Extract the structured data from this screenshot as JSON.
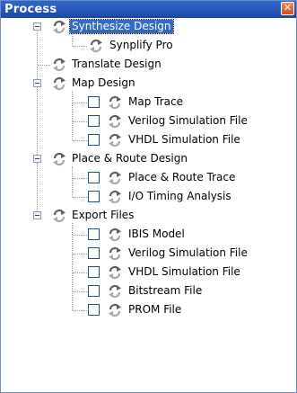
{
  "panel": {
    "title": "Process",
    "close_glyph": "✕"
  },
  "icons": {
    "expander": "minus-box-icon",
    "process": "process-arrows-icon",
    "process_colors": [
      "#5f5f5f",
      "#a8a8a8"
    ]
  },
  "selection_color": "#316ac5",
  "tree": [
    {
      "label": "Synthesize Design",
      "level": 0,
      "expanded": true,
      "selected": true
    },
    {
      "label": "Synplify Pro",
      "level": 1
    },
    {
      "label": "Translate Design",
      "level": 0
    },
    {
      "label": "Map Design",
      "level": 0,
      "expanded": true
    },
    {
      "label": "Map Trace",
      "level": 1,
      "checkbox": true
    },
    {
      "label": "Verilog Simulation File",
      "level": 1,
      "checkbox": true
    },
    {
      "label": "VHDL Simulation File",
      "level": 1,
      "checkbox": true
    },
    {
      "label": "Place & Route Design",
      "level": 0,
      "expanded": true
    },
    {
      "label": "Place & Route Trace",
      "level": 1,
      "checkbox": true
    },
    {
      "label": "I/O Timing Analysis",
      "level": 1,
      "checkbox": true
    },
    {
      "label": "Export Files",
      "level": 0,
      "expanded": true
    },
    {
      "label": "IBIS Model",
      "level": 1,
      "checkbox": true
    },
    {
      "label": "Verilog Simulation File",
      "level": 1,
      "checkbox": true
    },
    {
      "label": "VHDL Simulation File",
      "level": 1,
      "checkbox": true
    },
    {
      "label": "Bitstream File",
      "level": 1,
      "checkbox": true
    },
    {
      "label": "PROM File",
      "level": 1,
      "checkbox": true
    }
  ]
}
